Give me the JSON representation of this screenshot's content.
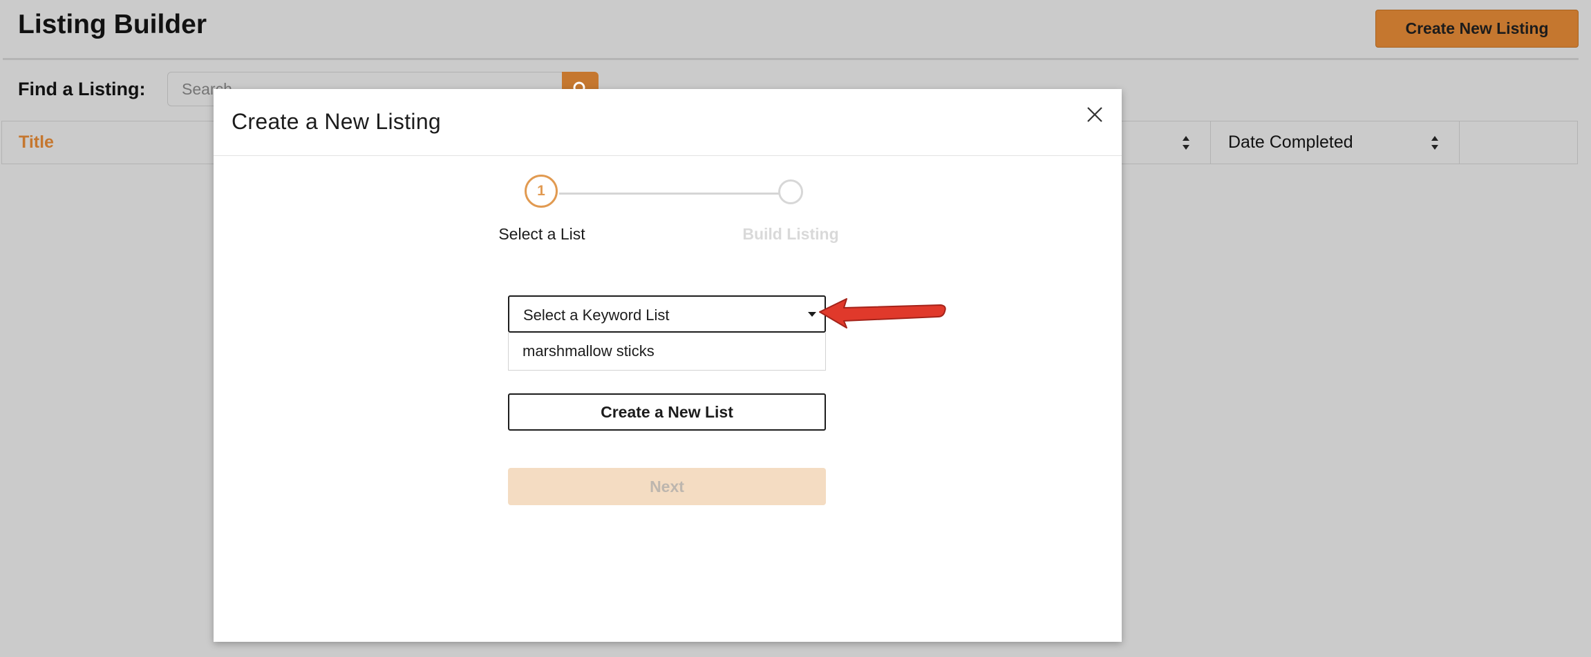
{
  "app": {
    "title": "Listing Builder",
    "create_button_label": "Create New Listing"
  },
  "find": {
    "label": "Find a Listing:",
    "search_placeholder": "Search"
  },
  "table": {
    "columns": [
      "Title",
      "Date Completed"
    ]
  },
  "modal": {
    "title": "Create a New Listing",
    "steps": [
      {
        "number": "1",
        "label": "Select a List",
        "state": "active"
      },
      {
        "number": "",
        "label": "Build Listing",
        "state": "inactive"
      }
    ],
    "select": {
      "value": "Select a Keyword List",
      "options": [
        "marshmallow sticks"
      ]
    },
    "create_list_button": "Create a New List",
    "next_button": "Next"
  },
  "colors": {
    "accent": "#c5772f",
    "step_active": "#e19a51",
    "next_disabled_bg": "#f4dcc2",
    "annotation_arrow": "#e0392b"
  },
  "icons": [
    "search-icon",
    "sort-icon",
    "close-icon",
    "caret-down-icon",
    "annotation-arrow"
  ]
}
